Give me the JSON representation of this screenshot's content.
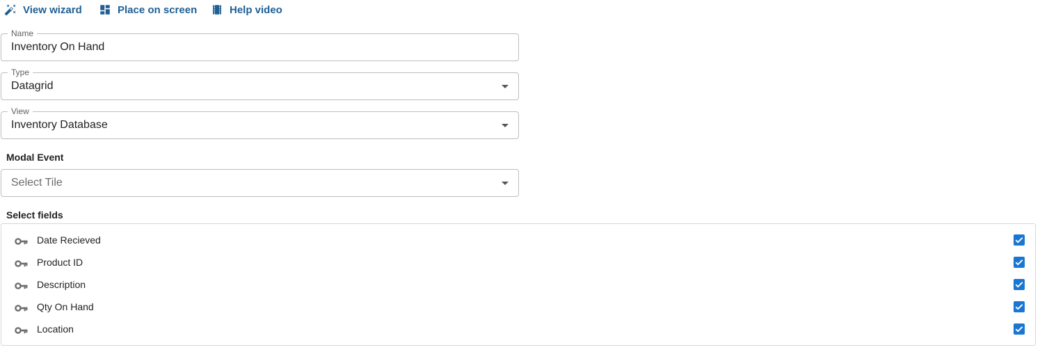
{
  "toolbar": {
    "view_wizard_label": "View wizard",
    "place_on_screen_label": "Place on screen",
    "help_video_label": "Help video"
  },
  "form": {
    "name": {
      "label": "Name",
      "value": "Inventory On Hand"
    },
    "type": {
      "label": "Type",
      "value": "Datagrid"
    },
    "view": {
      "label": "View",
      "value": "Inventory Database"
    },
    "modal_event": {
      "label": "Modal Event",
      "placeholder": "Select Tile"
    }
  },
  "select_fields": {
    "label": "Select fields",
    "items": [
      {
        "label": "Date Recieved",
        "checked": true
      },
      {
        "label": "Product ID",
        "checked": true
      },
      {
        "label": "Description",
        "checked": true
      },
      {
        "label": "Qty On Hand",
        "checked": true
      },
      {
        "label": "Location",
        "checked": true
      }
    ]
  },
  "colors": {
    "link": "#1f5f94",
    "checkbox": "#1976d2",
    "border": "#bdbdbd"
  }
}
